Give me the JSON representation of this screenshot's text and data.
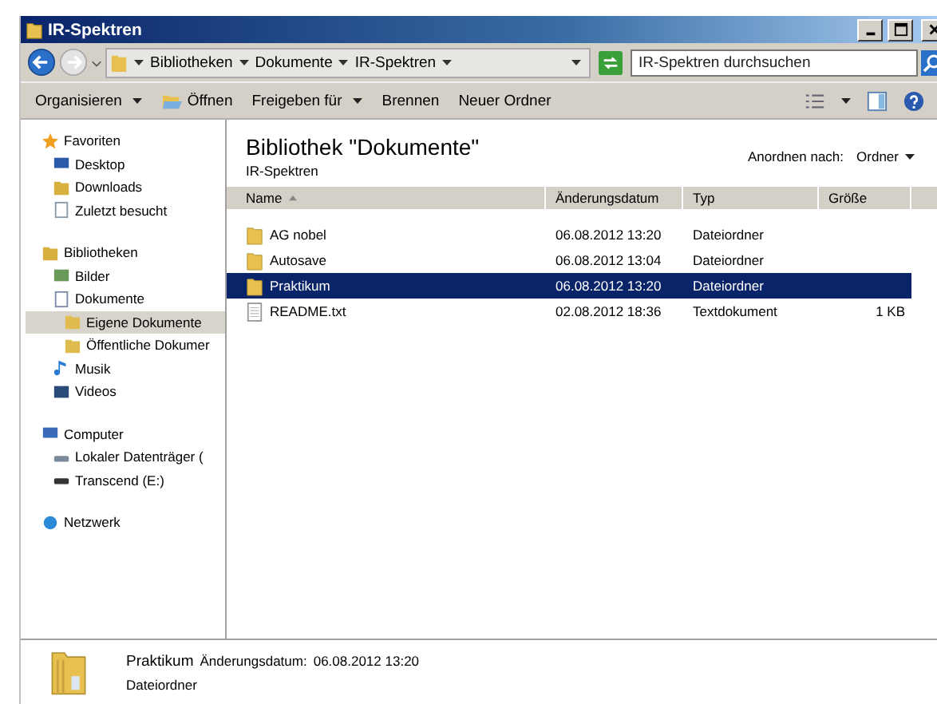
{
  "window": {
    "title": "IR-Spektren"
  },
  "address_bar": {
    "breadcrumbs": [
      "Bibliotheken",
      "Dokumente",
      "IR-Spektren"
    ]
  },
  "search": {
    "placeholder": "IR-Spektren durchsuchen"
  },
  "toolbar": [
    {
      "label": "Organisieren",
      "kind": "menu"
    },
    {
      "label": "Öffnen",
      "kind": "open"
    },
    {
      "label": "Freigeben für",
      "kind": "menu"
    },
    {
      "label": "Brennen",
      "kind": "plain"
    },
    {
      "label": "Neuer Ordner",
      "kind": "plain"
    }
  ],
  "sidebar": {
    "groups": [
      {
        "label": "Favoriten",
        "kind": "star",
        "selected": false,
        "children": [
          {
            "label": "Desktop",
            "kind": "desktop",
            "selected": false
          },
          {
            "label": "Downloads",
            "kind": "downloads",
            "selected": false
          },
          {
            "label": "Zuletzt besucht",
            "kind": "recent",
            "selected": false
          }
        ]
      },
      {
        "label": "Bibliotheken",
        "kind": "library",
        "selected": false,
        "children": [
          {
            "label": "Bilder",
            "kind": "pictures",
            "selected": false
          },
          {
            "label": "Dokumente",
            "kind": "document",
            "selected": false,
            "children": [
              {
                "label": "Eigene Dokumente",
                "kind": "folder",
                "selected": true
              },
              {
                "label": "Öffentliche Dokumer",
                "kind": "folder",
                "selected": false
              }
            ]
          },
          {
            "label": "Musik",
            "kind": "music",
            "selected": false
          },
          {
            "label": "Videos",
            "kind": "video",
            "selected": false
          }
        ]
      },
      {
        "label": "Computer",
        "kind": "computer",
        "selected": false,
        "children": [
          {
            "label": "Lokaler Datenträger (",
            "kind": "drive",
            "selected": false
          },
          {
            "label": "Transcend (E:)",
            "kind": "usb",
            "selected": false
          }
        ]
      },
      {
        "label": "Netzwerk",
        "kind": "network",
        "selected": false
      }
    ]
  },
  "library": {
    "title": "Bibliothek \"Dokumente\"",
    "subtitle": "IR-Spektren",
    "arrange_label": "Anordnen nach:",
    "arrange_value": "Ordner"
  },
  "table": {
    "columns": [
      "Name",
      "Änderungsdatum",
      "Typ",
      "Größe"
    ],
    "rows": [
      {
        "name": "AG nobel",
        "date": "06.08.2012 13:20",
        "type": "Dateiordner",
        "kind": "folder",
        "selected": false
      },
      {
        "name": "Autosave",
        "date": "06.08.2012 13:04",
        "type": "Dateiordner",
        "kind": "folder",
        "selected": false
      },
      {
        "name": "Praktikum",
        "date": "06.08.2012 13:20",
        "type": "Dateiordner",
        "kind": "folder",
        "selected": true
      },
      {
        "name": "README.txt",
        "date": "02.08.2012 18:36",
        "type": "Textdokument",
        "size": "1 KB",
        "kind": "text",
        "selected": false
      }
    ]
  },
  "details": {
    "name": "Praktikum",
    "date_label": "Änderungsdatum:",
    "date": "06.08.2012 13:20",
    "type": "Dateiordner"
  }
}
